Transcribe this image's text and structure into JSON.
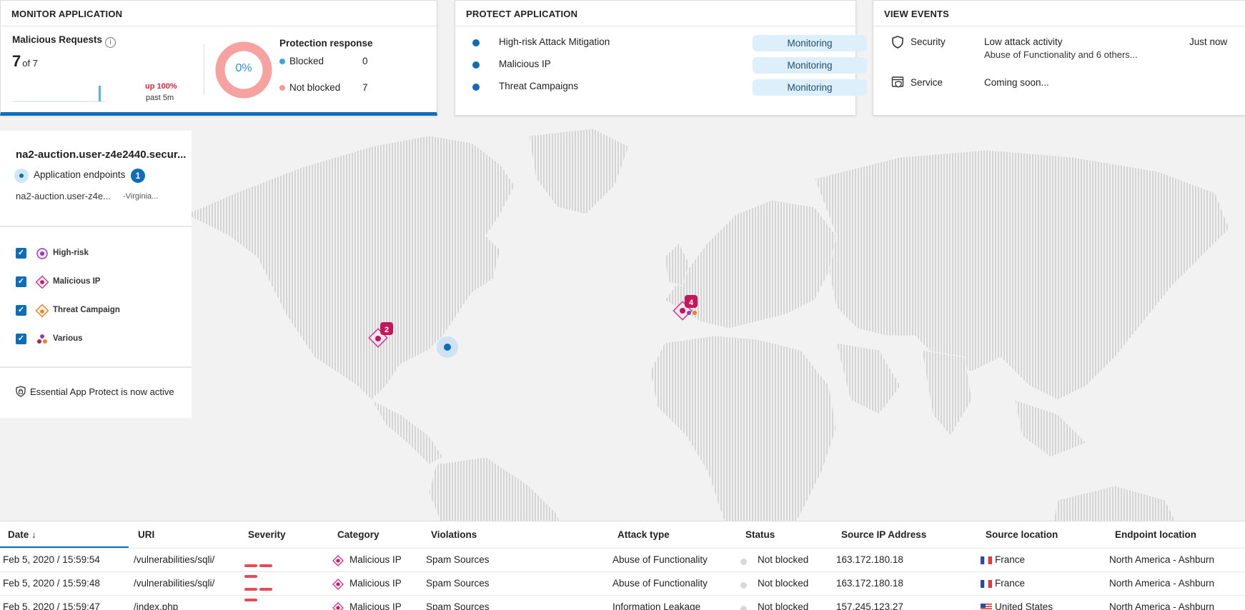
{
  "monitor": {
    "title": "MONITOR APPLICATION",
    "malicious_label": "Malicious Requests",
    "info_icon": "info-icon",
    "count": "7",
    "of_total": "of 7",
    "trend": "up 100%",
    "trend_period": "past 5m",
    "donut_percent": "0%",
    "donut_fraction": 0,
    "protection_title": "Protection response",
    "blocked_label": "Blocked",
    "blocked_value": "0",
    "not_blocked_label": "Not blocked",
    "not_blocked_value": "7",
    "colors": {
      "blocked": "#3aa6dd",
      "not_blocked": "#f39a9a",
      "accent": "#0f6cb6"
    }
  },
  "protect": {
    "title": "PROTECT APPLICATION",
    "items": [
      {
        "name": "High-risk Attack Mitigation",
        "status": "Monitoring"
      },
      {
        "name": "Malicious IP",
        "status": "Monitoring"
      },
      {
        "name": "Threat Campaigns",
        "status": "Monitoring"
      }
    ]
  },
  "events": {
    "title": "VIEW EVENTS",
    "security_label": "Security",
    "security_icon": "shield-icon",
    "security_title": "Low attack activity",
    "security_sub": "Abuse of Functionality and 6 others...",
    "security_time": "Just now",
    "service_label": "Service",
    "service_icon": "service-shield-icon",
    "service_title": "Coming soon..."
  },
  "app": {
    "name": "na2-auction.user-z4e2440.secur...",
    "endpoints_label": "Application endpoints",
    "endpoints_count": "1",
    "host": "na2-auction.user-z4e...",
    "region": "-Virginia...",
    "filters": [
      {
        "label": "High-risk",
        "icon": "high-risk-icon"
      },
      {
        "label": "Malicious IP",
        "icon": "malicious-ip-icon"
      },
      {
        "label": "Threat Campaign",
        "icon": "threat-campaign-icon"
      },
      {
        "label": "Various",
        "icon": "various-icon"
      }
    ],
    "status_text": "Essential App Protect is now active"
  },
  "map": {
    "markers": [
      {
        "name": "marker-us-west",
        "count": "2"
      },
      {
        "name": "marker-europe",
        "count": "4"
      }
    ]
  },
  "table": {
    "headers": [
      "Date ↓",
      "URI",
      "Severity",
      "Category",
      "Violations",
      "Attack type",
      "Status",
      "Source IP Address",
      "Source location",
      "Endpoint location"
    ],
    "rows": [
      {
        "date": "Feb 5, 2020 / 15:59:54",
        "uri": "/vulnerabilities/sqli/",
        "category": "Malicious IP",
        "violations": "Spam Sources",
        "attack": "Abuse of Functionality",
        "status": "Not blocked",
        "ip": "163.172.180.18",
        "src": "France",
        "flag": "fr",
        "endpoint": "North America - Ashburn"
      },
      {
        "date": "Feb 5, 2020 / 15:59:48",
        "uri": "/vulnerabilities/sqli/",
        "category": "Malicious IP",
        "violations": "Spam Sources",
        "attack": "Abuse of Functionality",
        "status": "Not blocked",
        "ip": "163.172.180.18",
        "src": "France",
        "flag": "fr",
        "endpoint": "North America - Ashburn"
      },
      {
        "date": "Feb 5, 2020 / 15:59:47",
        "uri": "/index.php",
        "category": "Malicious IP",
        "violations": "Spam Sources",
        "attack": "Information Leakage",
        "status": "Not blocked",
        "ip": "157.245.123.27",
        "src": "United States",
        "flag": "us",
        "endpoint": "North America - Ashburn"
      }
    ]
  }
}
